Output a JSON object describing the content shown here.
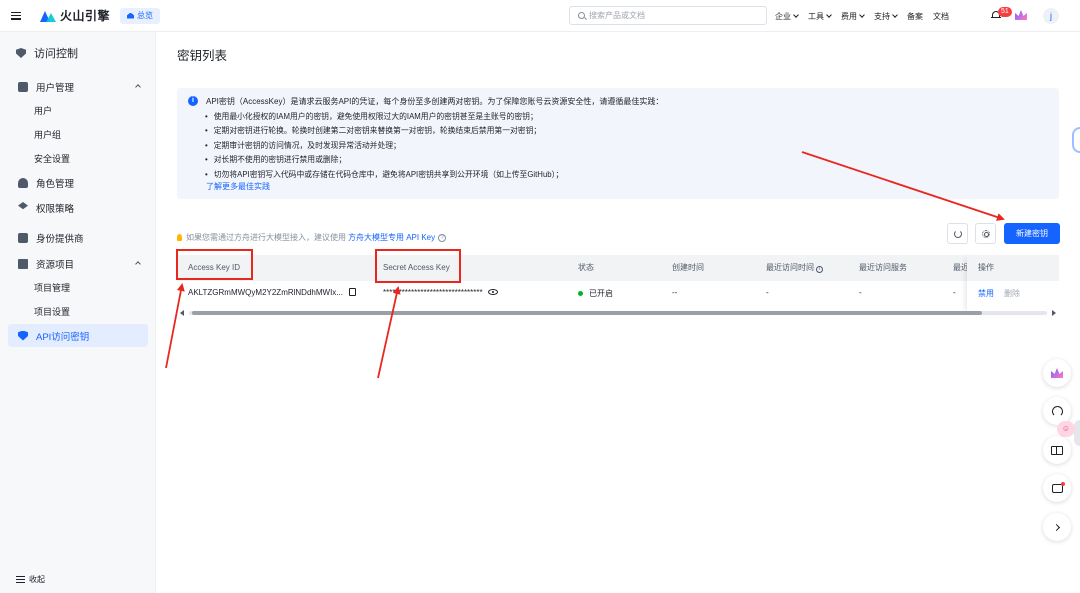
{
  "topbar": {
    "brand": "火山引擎",
    "overview_label": "总览",
    "search_placeholder": "搜索产品或文档",
    "nav": [
      {
        "label": "企业",
        "has_menu": true
      },
      {
        "label": "工具",
        "has_menu": true
      },
      {
        "label": "费用",
        "has_menu": true
      },
      {
        "label": "支持",
        "has_menu": true
      },
      {
        "label": "备案",
        "has_menu": false
      },
      {
        "label": "文档",
        "has_menu": false
      }
    ],
    "notification_count": "51",
    "avatar_initial": "j"
  },
  "sidebar": {
    "title": "访问控制",
    "groups": [
      {
        "label": "用户管理",
        "expanded": true,
        "items": [
          "用户",
          "用户组",
          "安全设置"
        ]
      },
      {
        "label": "角色管理"
      },
      {
        "label": "权限策略"
      },
      {
        "label": "身份提供商"
      },
      {
        "label": "资源项目",
        "expanded": true,
        "items": [
          "项目管理",
          "项目设置"
        ]
      }
    ],
    "active_item": "API访问密钥",
    "collapse_label": "收起"
  },
  "main": {
    "page_title": "密钥列表",
    "notice": {
      "heading": "API密钥（AccessKey）是请求云服务API的凭证，每个身份至多创建两对密钥。为了保障您账号云资源安全性，请遵循最佳实践：",
      "bullets": [
        "使用最小化授权的IAM用户的密钥，避免使用权限过大的IAM用户的密钥甚至是主账号的密钥；",
        "定期对密钥进行轮换。轮换时创建第二对密钥来替换第一对密钥，轮换结束后禁用第一对密钥；",
        "定期审计密钥的访问情况，及时发现异常活动并处理；",
        "对长期不使用的密钥进行禁用或删除；",
        "切勿将API密钥写入代码中或存储在代码仓库中，避免将API密钥共享到公开环境（如上传至GitHub）；"
      ],
      "more_link": "了解更多最佳实践"
    },
    "hint": {
      "text": "如果您需通过方舟进行大模型接入，建议使用",
      "link": "方舟大模型专用 API Key"
    },
    "create_button": "新建密钥",
    "table": {
      "columns": [
        "Access Key ID",
        "Secret Access Key",
        "状态",
        "创建时间",
        "最近访问时间",
        "最近访问服务",
        "最近",
        "操作"
      ],
      "rows": [
        {
          "access_key_id": "AKLTZGRmMWQyM2Y2ZmRlNDdhMWIx...",
          "secret_access_key": "********************************",
          "status": "已开启",
          "created": "--",
          "last_access_time": "-",
          "last_access_service": "-",
          "last_region": "-",
          "actions": [
            "禁用",
            "删除"
          ]
        }
      ]
    }
  },
  "colors": {
    "accent": "#1664ff",
    "annotation": "#e8281e",
    "status_ok": "#00b42a"
  }
}
